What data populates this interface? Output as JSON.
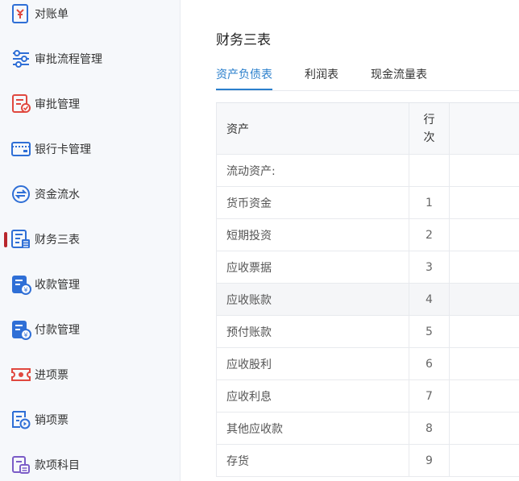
{
  "sidebar": {
    "items": [
      {
        "label": "对账单",
        "icon": "receipt-icon"
      },
      {
        "label": "审批流程管理",
        "icon": "sliders-icon"
      },
      {
        "label": "审批管理",
        "icon": "approval-document-icon"
      },
      {
        "label": "银行卡管理",
        "icon": "bank-card-icon"
      },
      {
        "label": "资金流水",
        "icon": "exchange-icon"
      },
      {
        "label": "财务三表",
        "icon": "finance-report-icon",
        "active": true
      },
      {
        "label": "收款管理",
        "icon": "collection-icon"
      },
      {
        "label": "付款管理",
        "icon": "payment-icon"
      },
      {
        "label": "进项票",
        "icon": "input-invoice-icon"
      },
      {
        "label": "销项票",
        "icon": "output-invoice-icon"
      },
      {
        "label": "款项科目",
        "icon": "account-subject-icon"
      }
    ]
  },
  "main": {
    "title": "财务三表",
    "tabs": [
      {
        "label": "资产负债表",
        "active": true
      },
      {
        "label": "利润表"
      },
      {
        "label": "现金流量表"
      }
    ],
    "table": {
      "headers": {
        "asset": "资产",
        "line_no_1": "行",
        "line_no_2": "次"
      },
      "rows": [
        {
          "asset": "流动资产:",
          "line": ""
        },
        {
          "asset": "货币资金",
          "line": "1"
        },
        {
          "asset": "短期投资",
          "line": "2"
        },
        {
          "asset": "应收票据",
          "line": "3"
        },
        {
          "asset": "应收账款",
          "line": "4"
        },
        {
          "asset": "预付账款",
          "line": "5"
        },
        {
          "asset": "应收股利",
          "line": "6"
        },
        {
          "asset": "应收利息",
          "line": "7"
        },
        {
          "asset": "其他应收款",
          "line": "8"
        },
        {
          "asset": "存货",
          "line": "9"
        }
      ]
    }
  },
  "colors": {
    "accent": "#2a7fcc",
    "active_marker": "#b8262c",
    "icon_blue": "#2f6fd6",
    "icon_red": "#e0483f"
  }
}
